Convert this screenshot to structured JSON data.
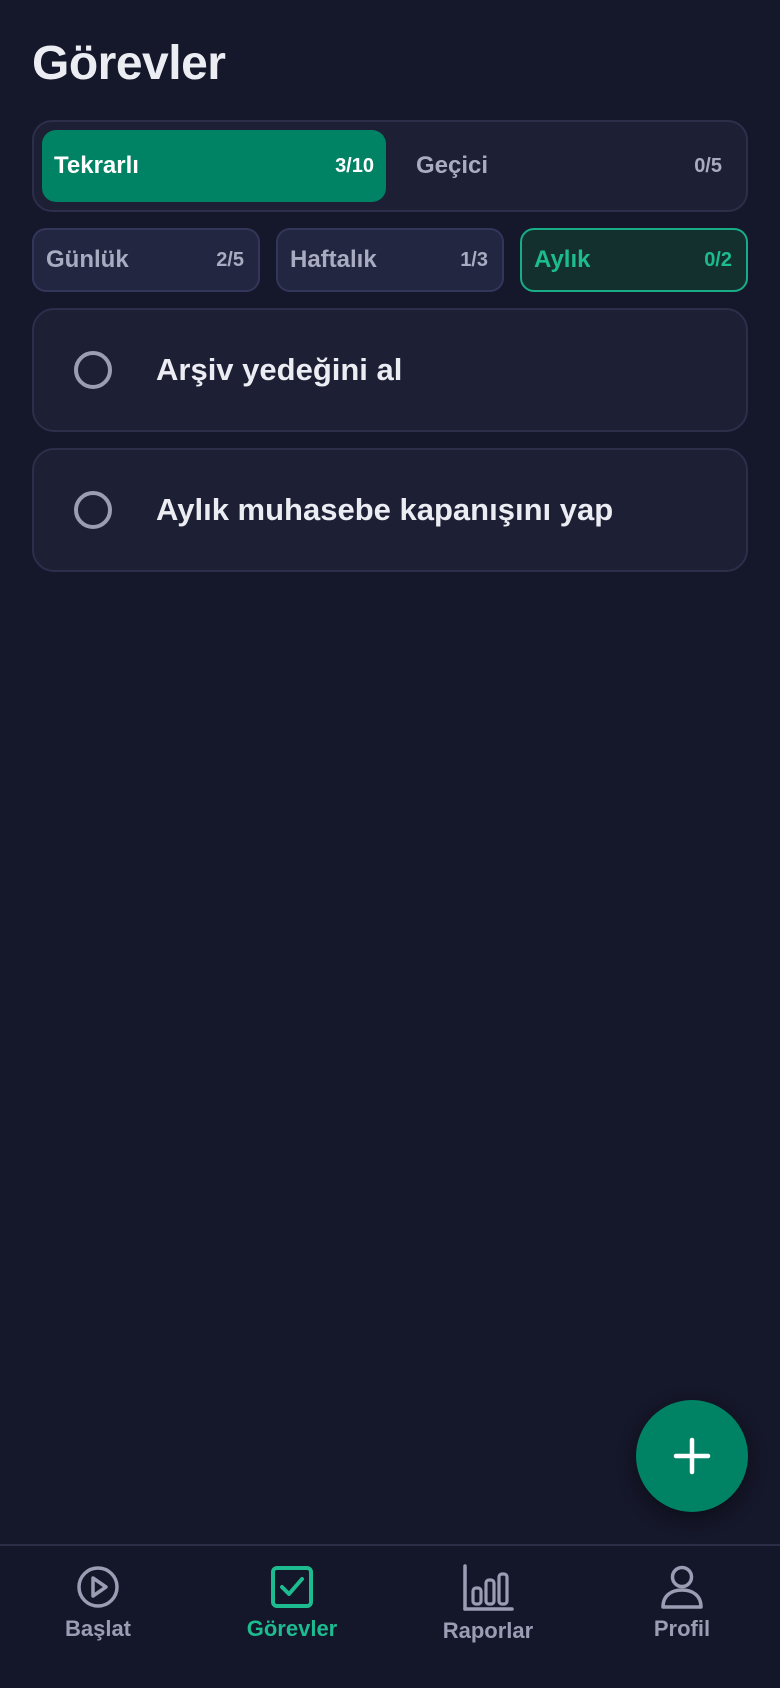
{
  "page": {
    "title": "Görevler"
  },
  "segments": [
    {
      "label": "Tekrarlı",
      "count": "3/10",
      "active": true
    },
    {
      "label": "Geçici",
      "count": "0/5",
      "active": false
    }
  ],
  "periods": [
    {
      "label": "Günlük",
      "count": "2/5",
      "selected": false
    },
    {
      "label": "Haftalık",
      "count": "1/3",
      "selected": false
    },
    {
      "label": "Aylık",
      "count": "0/2",
      "selected": true
    }
  ],
  "tasks": [
    {
      "title": "Arşiv yedeğini al",
      "done": false
    },
    {
      "title": "Aylık muhasebe kapanışını yap",
      "done": false
    }
  ],
  "fab": {
    "icon": "plus-icon"
  },
  "nav": [
    {
      "label": "Başlat",
      "icon": "play-icon",
      "active": false
    },
    {
      "label": "Görevler",
      "icon": "checkbox-icon",
      "active": true
    },
    {
      "label": "Raporlar",
      "icon": "bar-chart-icon",
      "active": false
    },
    {
      "label": "Profil",
      "icon": "user-icon",
      "active": false
    }
  ],
  "colors": {
    "background": "#15172a",
    "accent": "#008264",
    "accent_text": "#1dbb90",
    "card": "#1d1f35",
    "muted": "#9a9db3"
  }
}
